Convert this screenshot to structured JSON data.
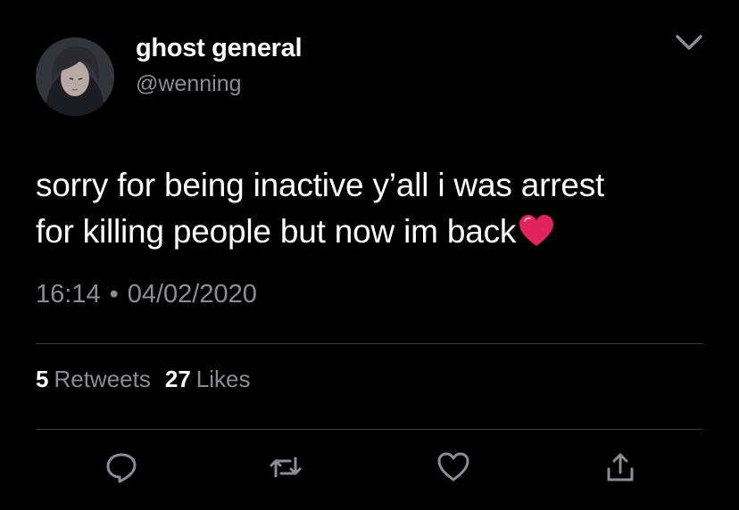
{
  "user": {
    "display_name": "ghost general",
    "handle": "@wenning",
    "avatar": "avatar"
  },
  "tweet": {
    "line1": "sorry for being inactive y’all i was arrest",
    "line2": "for killing people but now im back",
    "emoji": "red-heart-emoji",
    "time": "16:14",
    "separator": "•",
    "date": "04/02/2020"
  },
  "stats": {
    "retweets_count": "5",
    "retweets_label": "Retweets",
    "likes_count": "27",
    "likes_label": "Likes"
  },
  "actions": [
    "reply-icon",
    "retweet-icon",
    "like-icon",
    "share-icon"
  ],
  "colors": {
    "background": "#000000",
    "text": "#ffffff",
    "secondary_text": "#8a8d91",
    "divider": "#3a3d40",
    "heart": "#e0245e"
  }
}
